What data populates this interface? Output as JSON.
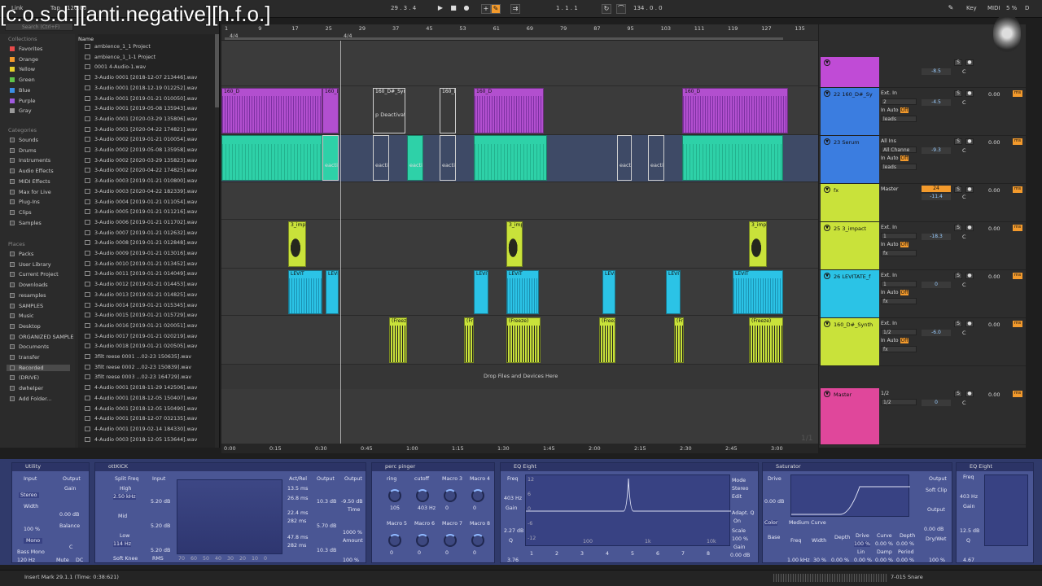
{
  "watermark": "[c.o.s.d.][anti.negative][h.f.o.]",
  "topbar": {
    "menu": [
      "Link",
      "Tap",
      "120.00"
    ],
    "position": "29 . 3 . 4",
    "loop_start": "1 . 1 . 1",
    "loop_length": "134 . 0 . 0",
    "key_label": "Key",
    "midi_label": "MIDI",
    "cpu": "5 %",
    "d_label": "D"
  },
  "browser": {
    "search_placeholder": "Search (Ctrl+F)",
    "collections_title": "Collections",
    "collections": [
      {
        "label": "Favorites",
        "color": "#e84a4a"
      },
      {
        "label": "Orange",
        "color": "#f39a2c"
      },
      {
        "label": "Yellow",
        "color": "#e6d02c"
      },
      {
        "label": "Green",
        "color": "#5fc34a"
      },
      {
        "label": "Blue",
        "color": "#3b8fe6"
      },
      {
        "label": "Purple",
        "color": "#a05ae0"
      },
      {
        "label": "Gray",
        "color": "#9a9a9a"
      }
    ],
    "categories_title": "Categories",
    "categories": [
      "Sounds",
      "Drums",
      "Instruments",
      "Audio Effects",
      "MIDI Effects",
      "Max for Live",
      "Plug-Ins",
      "Clips",
      "Samples"
    ],
    "places_title": "Places",
    "places": [
      "Packs",
      "User Library",
      "Current Project",
      "Downloads",
      "resamples",
      "SAMPLES",
      "Music",
      "Desktop",
      "ORGANIZED SAMPLE",
      "Documents",
      "transfer",
      "Recorded",
      "(DRIVE)",
      "dwhelper",
      "Add Folder..."
    ],
    "name_header": "Name",
    "files": [
      "ambience_1_1 Project",
      "ambience_1_1-1 Project",
      "0001 4-Audio-1.wav",
      "3-Audio 0001 [2018-12-07 213446].wav",
      "3-Audio 0001 [2018-12-19 012252].wav",
      "3-Audio 0001 [2019-01-21 010050].wav",
      "3-Audio 0001 [2019-05-08 135943].wav",
      "3-Audio 0001 [2020-03-29 135806].wav",
      "3-Audio 0001 [2020-04-22 174821].wav",
      "3-Audio 0002 [2019-01-21 010054].wav",
      "3-Audio 0002 [2019-05-08 135958].wav",
      "3-Audio 0002 [2020-03-29 135823].wav",
      "3-Audio 0002 [2020-04-22 174825].wav",
      "3-Audio 0003 [2019-01-21 010800].wav",
      "3-Audio 0003 [2020-04-22 182339].wav",
      "3-Audio 0004 [2019-01-21 011054].wav",
      "3-Audio 0005 [2019-01-21 011216].wav",
      "3-Audio 0006 [2019-01-21 011702].wav",
      "3-Audio 0007 [2019-01-21 012632].wav",
      "3-Audio 0008 [2019-01-21 012848].wav",
      "3-Audio 0009 [2019-01-21 013016].wav",
      "3-Audio 0010 [2019-01-21 013452].wav",
      "3-Audio 0011 [2019-01-21 014049].wav",
      "3-Audio 0012 [2019-01-21 014453].wav",
      "3-Audio 0013 [2019-01-21 014825].wav",
      "3-Audio 0014 [2019-01-21 015345].wav",
      "3-Audio 0015 [2019-01-21 015729].wav",
      "3-Audio 0016 [2019-01-21 020051].wav",
      "3-Audio 0017 [2019-01-21 020219].wav",
      "3-Audio 0018 [2019-01-21 020505].wav",
      "3filt reese 0001 ...02-23 150635].wav",
      "3filt reese 0002 ...02-23 150839].wav",
      "3filt reese 0003 ...02-23 164729].wav",
      "4-Audio 0001 [2018-11-29 142506].wav",
      "4-Audio 0001 [2018-12-05 150407].wav",
      "4-Audio 0001 [2018-12-05 150490].wav",
      "4-Audio 0001 [2018-12-07 032135].wav",
      "4-Audio 0001 [2019-02-14 184330].wav",
      "4-Audio 0003 [2018-12-05 153644].wav"
    ]
  },
  "arrangement": {
    "bars": [
      "1",
      "9",
      "17",
      "25",
      "29",
      "37",
      "45",
      "53",
      "61",
      "69",
      "79",
      "87",
      "95",
      "103",
      "111",
      "119",
      "127",
      "135"
    ],
    "time_sig": "4/4",
    "drop_hint": "Drop Files and Devices Here",
    "page_counter": "1/1",
    "times": [
      "0:00",
      "0:15",
      "0:30",
      "0:45",
      "1:00",
      "1:15",
      "1:30",
      "1:45",
      "2:00",
      "2:15",
      "2:30",
      "2:45",
      "3:00"
    ],
    "clip_labels": {
      "synth": "160_D",
      "synth2": "160_D#_Syn",
      "deactivated": "p Deactivat",
      "serum_deact": "eactiv",
      "impact": "3_imp",
      "levitate": "LEVIT",
      "freeze": "(Freeze)"
    }
  },
  "mixer": {
    "tracks": [
      {
        "name": "",
        "color": "#c04bd6",
        "in": "",
        "vol": "-8.5",
        "send": ""
      },
      {
        "name": "22 160_D#_Sy",
        "color": "#3b7de0",
        "in": "Ext. In",
        "ch": "2",
        "vol": "-4.5",
        "out": "leads",
        "send": "0.00"
      },
      {
        "name": "23 Serum",
        "color": "#3b7de0",
        "in": "All Ins",
        "ch": "All Channe",
        "vol": "-9.3",
        "out": "leads",
        "send": "0.00"
      },
      {
        "name": "fx",
        "color": "#c9e23a",
        "in": "Master",
        "vol": "-11.4",
        "vol2": "24",
        "send": "0.00"
      },
      {
        "name": "25 3_impact",
        "color": "#c9e23a",
        "in": "Ext. In",
        "ch": "1",
        "vol": "-18.3",
        "out": "fx",
        "send": "0.00"
      },
      {
        "name": "26 LEVITATE_f",
        "color": "#2bc3e6",
        "in": "Ext. In",
        "ch": "1",
        "vol": "0",
        "out": "fx",
        "send": "0.00"
      },
      {
        "name": "160_D#_Synth",
        "color": "#c9e23a",
        "in": "Ext. In",
        "ch": "1/2",
        "vol": "-6.0",
        "out": "fx",
        "send": "0.00"
      },
      {
        "name": "Master",
        "color": "#e0479b",
        "in": "1/2",
        "ch": "1/2",
        "vol": "0",
        "send": "0.00"
      }
    ],
    "auto_label": "Auto",
    "off_label": "Off",
    "in_label": "In",
    "sends_label": "Sends",
    "c_label": "C",
    "ms_label": "ms"
  },
  "devices": {
    "utility": {
      "title": "Utility",
      "input": "Input",
      "output": "Output",
      "gain": "Gain",
      "stereo": "Stereo",
      "width": "Width",
      "width_val": "100 %",
      "gain_val": "0.00 dB",
      "balance": "Balance",
      "balance_val": "C",
      "mono": "Mono",
      "bass_mono": "Bass Mono",
      "bass_freq": "120 Hz",
      "mute": "Mute",
      "dc": "DC"
    },
    "ott": {
      "title": "ottKICK",
      "split": "Split Freq",
      "input": "Input",
      "high": "High",
      "high_freq": "2.50 kHz",
      "mid": "Mid",
      "low": "Low",
      "low_freq": "114 Hz",
      "g1": "5.20 dB",
      "g2": "5.20 dB",
      "g3": "5.20 dB",
      "actrel": "Act/Rel",
      "times": [
        "13.5 ms",
        "26.8 ms",
        "22.4 ms",
        "282 ms",
        "47.8 ms",
        "282 ms"
      ],
      "output": "Output",
      "out_vals": [
        "10.3 dB",
        "5.70 dB",
        "10.3 dB"
      ],
      "scale": [
        "70",
        "60",
        "50",
        "40",
        "30",
        "20",
        "10",
        "0"
      ],
      "softknee": "Soft Knee",
      "rms": "RMS",
      "output2": "Output",
      "out2": "-9.50 dB",
      "time": "Time",
      "time_val": "1000 %",
      "amount": "Amount",
      "amount_val": "100 %"
    },
    "perc": {
      "title": "perc pinger",
      "macros": [
        "ring",
        "cutoff",
        "Macro 3",
        "Macro 4",
        "Macro 5",
        "Macro 6",
        "Macro 7",
        "Macro 8"
      ],
      "values": [
        "105",
        "403 Hz",
        "0",
        "0",
        "0",
        "0",
        "0",
        "0"
      ]
    },
    "eq": {
      "title": "EQ Eight",
      "freq": "Freq",
      "freq_val": "403 Hz",
      "gain": "Gain",
      "gain_val": "2.27 dB",
      "q": "Q",
      "q_val": "3.76",
      "mode": "Mode",
      "stereo": "Stereo",
      "edit": "Edit",
      "adapt": "Adapt. Q",
      "adapt_val": "On",
      "scale": "Scale",
      "scale_val": "100 %",
      "gain2": "Gain",
      "gain2_val": "0.00 dB",
      "db": [
        "12",
        "6",
        "0",
        "-6",
        "-12"
      ],
      "freqs": [
        "100",
        "1k",
        "10k"
      ],
      "bands": [
        "1",
        "2",
        "3",
        "4",
        "5",
        "6",
        "7",
        "8"
      ]
    },
    "saturator": {
      "title": "Saturator",
      "drive": "Drive",
      "drive_val": "0.00 dB",
      "type": "Medium Curve",
      "color": "Color",
      "base": "Base",
      "freq": "Freq",
      "freq_val": "1.00 kHz",
      "width": "Width",
      "width_val": "30 %",
      "depth": "Depth",
      "depth_val": "0.00 %",
      "drive2": "Drive",
      "drive2_val": "100 %",
      "lin": "Lin",
      "lin_val": "0.00 %",
      "curve": "Curve",
      "curve_val": "0.00 %",
      "damp": "Damp",
      "damp_val": "0.00 %",
      "depth2": "Depth",
      "depth2_val": "0.00 %",
      "period": "Period",
      "period_val": "0.00 %",
      "output": "Output",
      "soft_clip": "Soft Clip",
      "out_val": "0.00 dB",
      "drywet": "Dry/Wet",
      "drywet_val": "100 %"
    },
    "eq2": {
      "title": "EQ Eight",
      "freq": "Freq",
      "freq_val": "403 Hz",
      "gain": "Gain",
      "gain_val": "12.5 dB",
      "q": "Q",
      "q_val": "4.67"
    }
  },
  "status": {
    "message": "Insert Mark 29.1.1 (Time: 0:38:621)",
    "track": "7-015 Snare"
  }
}
